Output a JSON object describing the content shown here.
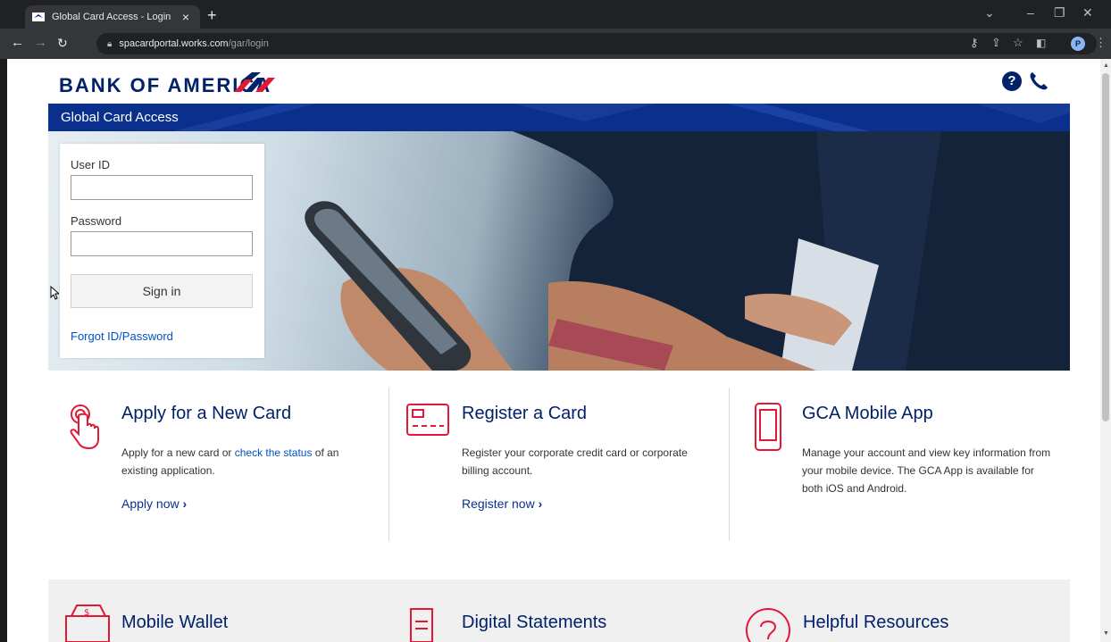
{
  "browser": {
    "tab_title": "Global Card Access - Login",
    "tab_close": "×",
    "new_tab": "+",
    "url_host": "spacardportal.works.com",
    "url_path": "/gar/login",
    "profile_initial": "P",
    "icons": [
      "back-icon",
      "forward-icon",
      "reload-icon",
      "lock-icon",
      "key-icon",
      "share-icon",
      "star-icon",
      "sidebar-icon",
      "menu-icon"
    ]
  },
  "header": {
    "logo_text": "BANK OF AMERICA",
    "band_title": "Global Card Access",
    "help_glyph": "?"
  },
  "login": {
    "user_id_label": "User ID",
    "user_id_value": "",
    "password_label": "Password",
    "password_value": "",
    "sign_in_label": "Sign in",
    "forgot_label": "Forgot ID/Password"
  },
  "features": [
    {
      "title": "Apply for a New Card",
      "desc_before": "Apply for a new card or ",
      "desc_link": "check the status",
      "desc_after": " of an existing application.",
      "link": "Apply now",
      "icon": "tap-finger-icon"
    },
    {
      "title": "Register a Card",
      "desc": "Register your corporate credit card or corporate billing account.",
      "link": "Register now",
      "icon": "credit-card-icon"
    },
    {
      "title": "GCA Mobile App",
      "desc": "Manage your account and view key information from your mobile device. The GCA App is available for both iOS and Android.",
      "icon": "mobile-phone-icon"
    }
  ],
  "lower_features": [
    {
      "title": "Mobile Wallet",
      "icon": "wallet-icon"
    },
    {
      "title": "Digital Statements",
      "icon": "document-icon"
    },
    {
      "title": "Helpful Resources",
      "icon": "question-circle-icon"
    }
  ],
  "colors": {
    "brand_navy": "#012169",
    "band_blue": "#0a2f8c",
    "brand_red": "#e31837",
    "link_blue": "#0052c2"
  }
}
